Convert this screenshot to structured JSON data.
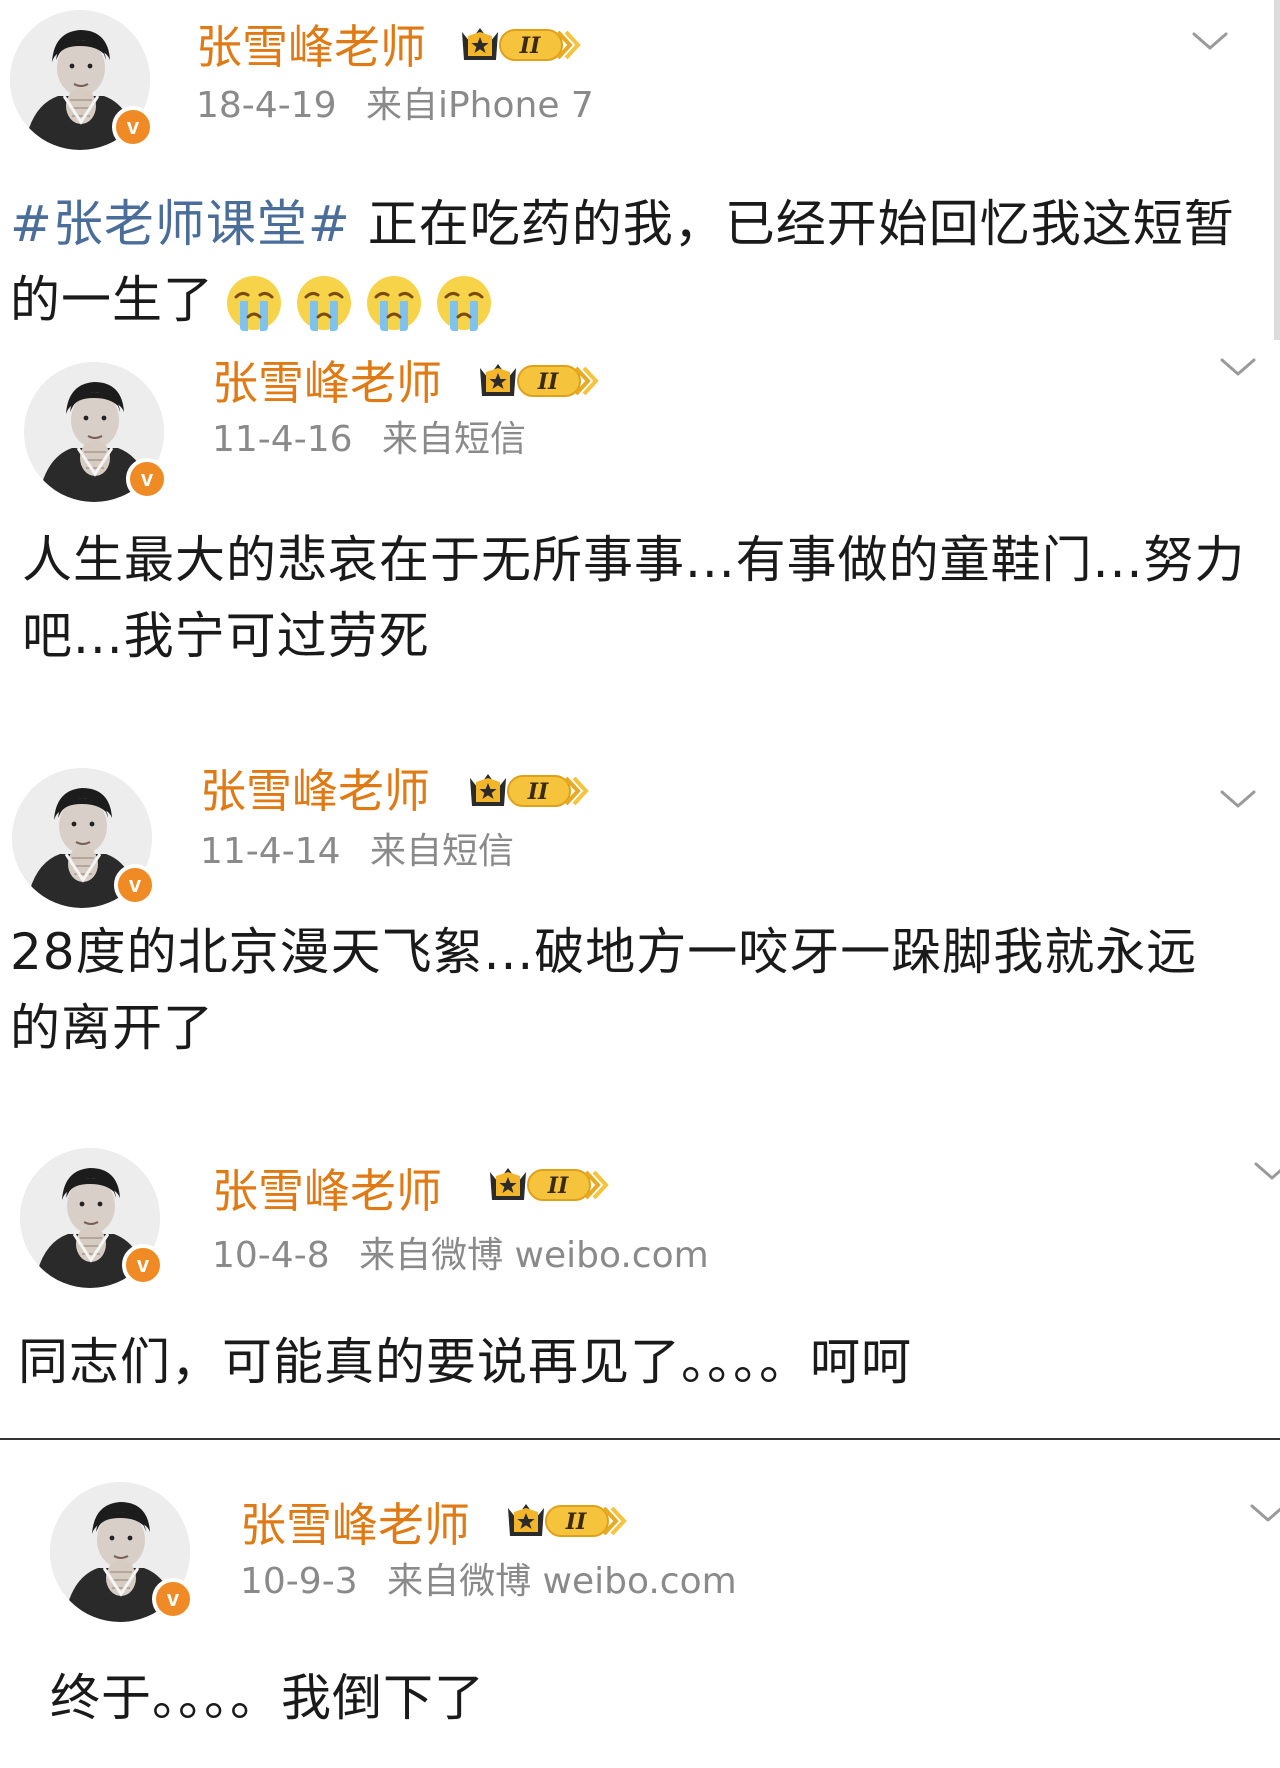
{
  "posts": [
    {
      "username": "张雪峰老师",
      "level": "II",
      "date": "18-4-19",
      "source": "来自iPhone 7",
      "topic": "#张老师课堂#",
      "text": " 正在吃药的我，已经开始回忆我这短暂的一生了",
      "emoji": "crying-face",
      "emoji_count": 4
    },
    {
      "username": "张雪峰老师",
      "level": "II",
      "date": "11-4-16",
      "source": "来自短信",
      "topic": "",
      "text": "人生最大的悲哀在于无所事事...有事做的童鞋门...努力吧...我宁可过劳死"
    },
    {
      "username": "张雪峰老师",
      "level": "II",
      "date": "11-4-14",
      "source": "来自短信",
      "topic": "",
      "text": "28度的北京漫天飞絮...破地方一咬牙一跺脚我就永远的离开了"
    },
    {
      "username": "张雪峰老师",
      "level": "II",
      "date": "10-4-8",
      "source": "来自微博 weibo.com",
      "topic": "",
      "text": "同志们，可能真的要说再见了。。。。呵呵"
    },
    {
      "username": "张雪峰老师",
      "level": "II",
      "date": "10-9-3",
      "source": "来自微博 weibo.com",
      "topic": "",
      "text": "终于。。。。我倒下了"
    }
  ],
  "colors": {
    "username": "#e07a14",
    "meta": "#8a8a8a",
    "topic": "#4a6d9a",
    "badge": "#f08a24",
    "crown_gold": "#f3b62b"
  },
  "icons": {
    "verified": "verified-v-badge",
    "level": "crown-level-badge",
    "menu": "chevron-down-icon"
  }
}
